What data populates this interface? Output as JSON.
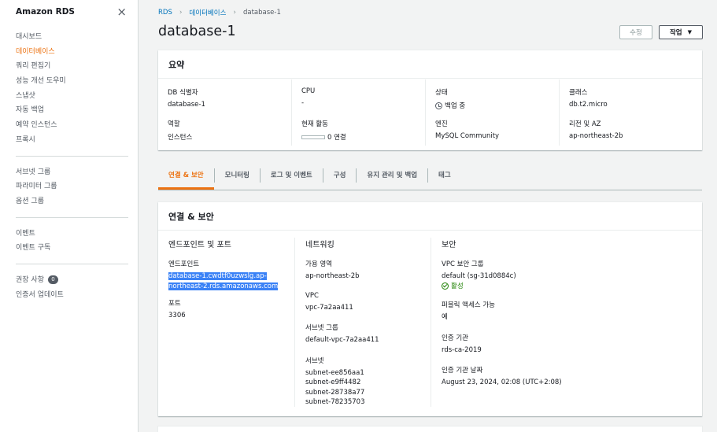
{
  "sidebar": {
    "title": "Amazon RDS",
    "close_icon": "×",
    "group1": [
      "대시보드",
      "데이터베이스",
      "쿼리 편집기",
      "성능 개선 도우미",
      "스냅샷",
      "자동 백업",
      "예약 인스턴스",
      "프록시"
    ],
    "group2": [
      "서브넷 그룹",
      "파라미터 그룹",
      "옵션 그룹"
    ],
    "group3": [
      "이벤트",
      "이벤트 구독"
    ],
    "group4": [
      "권장 사항",
      "인증서 업데이트"
    ],
    "recommend_count": "0"
  },
  "breadcrumb": [
    "RDS",
    "데이터베이스",
    "database-1"
  ],
  "breadcrumb_sep": "›",
  "title": "database-1",
  "buttons": {
    "edit": "수정",
    "actions": "작업",
    "actions_caret": "▼"
  },
  "summary": {
    "title": "요약",
    "db_id_label": "DB 식별자",
    "db_id": "database-1",
    "cpu_label": "CPU",
    "cpu": "-",
    "status_label": "상태",
    "status": "백업 중",
    "class_label": "클래스",
    "class": "db.t2.micro",
    "role_label": "역할",
    "role": "인스턴스",
    "activity_label": "현재 활동",
    "activity": "0 연결",
    "engine_label": "엔진",
    "engine": "MySQL Community",
    "region_label": "리전 및 AZ",
    "region": "ap-northeast-2b"
  },
  "tabs": [
    "연결 & 보안",
    "모니터링",
    "로그 및 이벤트",
    "구성",
    "유지 관리 및 백업",
    "태그"
  ],
  "conn": {
    "title": "연결 & 보안",
    "endpoint_head": "엔드포인트 및 포트",
    "endpoint_label": "엔드포인트",
    "endpoint_line1": "database-1.cwdtf0uzwslg.ap-",
    "endpoint_line2": "northeast-2.rds.amazonaws.com",
    "port_label": "포트",
    "port": "3306",
    "network_head": "네트워킹",
    "az_label": "가용 영역",
    "az": "ap-northeast-2b",
    "vpc_label": "VPC",
    "vpc": "vpc-7a2aa411",
    "subnet_group_label": "서브넷 그룹",
    "subnet_group": "default-vpc-7a2aa411",
    "subnets_label": "서브넷",
    "subnets": [
      "subnet-ee856aa1",
      "subnet-e9ff4482",
      "subnet-28738a77",
      "subnet-78235703"
    ],
    "security_head": "보안",
    "sg_label": "VPC 보안 그룹",
    "sg": "default (sg-31d0884c)",
    "sg_status": "활성",
    "public_label": "퍼블릭 액세스 가능",
    "public": "예",
    "ca_label": "인증 기관",
    "ca": "rds-ca-2019",
    "ca_date_label": "인증 기관 날짜",
    "ca_date": "August 23, 2024, 02:08 (UTC+2:08)"
  },
  "colors": {
    "accent": "#ec7211",
    "link": "#0073bb",
    "success": "#1d8102"
  }
}
